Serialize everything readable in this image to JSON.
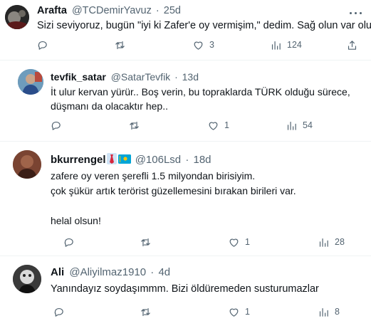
{
  "tweets": [
    {
      "name": "Arafta",
      "handle": "@TCDemirYavuz",
      "sep": "·",
      "time": "25d",
      "lines": [
        "Sizi seviyoruz, bugün \"iyi ki Zafer'e oy vermişim,\" dedim. Sağ olun var olun."
      ],
      "actions": {
        "reply": "",
        "retweet": "",
        "like": "3",
        "views": "124"
      }
    },
    {
      "name": "tevfik_satar",
      "handle": "@SatarTevfik",
      "sep": "·",
      "time": "13d",
      "lines": [
        "İt ulur kervan yürür.. Boş verin, bu topraklarda TÜRK olduğu sürece,",
        "düşmanı da olacaktır hep.."
      ],
      "actions": {
        "reply": "",
        "retweet": "",
        "like": "1",
        "views": "54"
      }
    },
    {
      "name": "bkurrengel",
      "handle": "@106Lsd",
      "sep": "·",
      "time": "18d",
      "lines": [
        "zafere oy veren şerefli 1.5 milyondan birisiyim.",
        "çok şükür artık terörist güzellemesini bırakan birileri var.",
        "",
        "helal olsun!"
      ],
      "actions": {
        "reply": "",
        "retweet": "",
        "like": "1",
        "views": "28"
      }
    },
    {
      "name": "Ali",
      "handle": "@Aliyilmaz1910",
      "sep": "·",
      "time": "4d",
      "lines": [
        "Yanındayız soydaşımmm. Bizi öldüremeden susturumazlar"
      ],
      "actions": {
        "reply": "",
        "retweet": "",
        "like": "1",
        "views": "8"
      }
    }
  ],
  "icons": {
    "reply": "reply-icon",
    "retweet": "retweet-icon",
    "like": "heart-icon",
    "views": "views-icon",
    "share": "share-icon",
    "more": "more-icon",
    "badges": [
      "necktie-emoji-icon",
      "kazakhstan-flag-icon"
    ]
  },
  "colors": {
    "text": "#0f1419",
    "muted": "#536471",
    "divider": "#eff3f4"
  }
}
